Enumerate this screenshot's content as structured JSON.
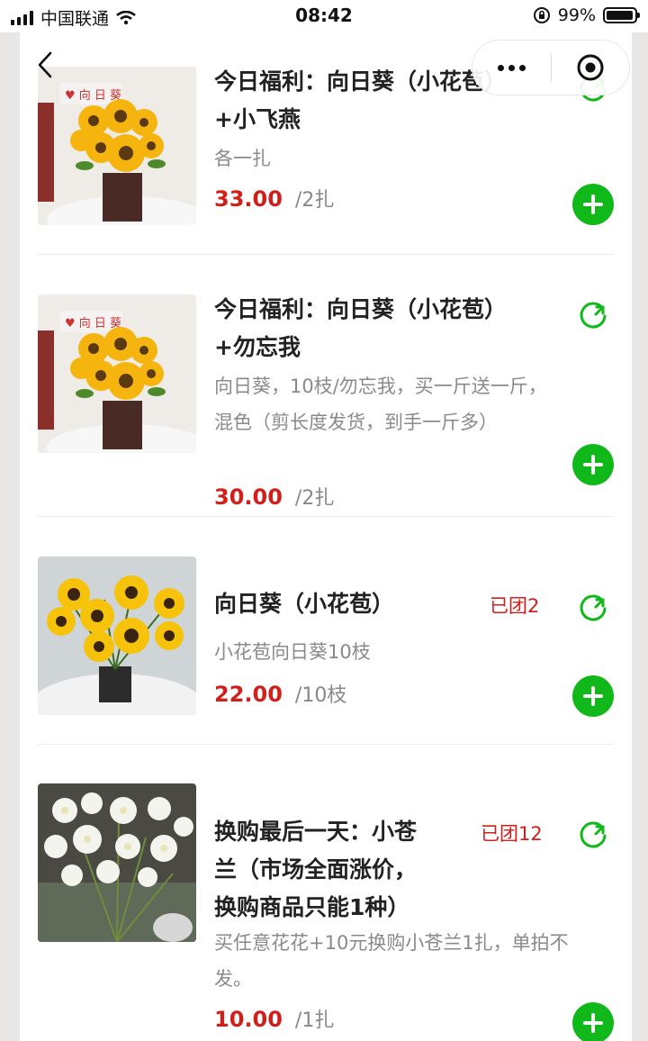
{
  "status_bar": {
    "carrier": "中国联通",
    "time": "08:42",
    "battery": "99%"
  },
  "nav": {
    "back_icon": "chevron-left-icon",
    "more_icon": "more-dots-icon",
    "home_icon": "target-icon"
  },
  "products": [
    {
      "title_line1": "今日福利：向日葵（小花苞）",
      "title_line2": "+小飞燕",
      "desc_line1": "各一扎",
      "desc_line2": "",
      "price": "33.00",
      "unit": "/2扎",
      "grouped": ""
    },
    {
      "title_line1": "今日福利：向日葵（小花苞）",
      "title_line2": "+勿忘我",
      "desc_line1": "向日葵，10枝/勿忘我，买一斤送一斤，",
      "desc_line2": "混色（剪长度发货，到手一斤多）",
      "price": "30.00",
      "unit": "/2扎",
      "grouped": ""
    },
    {
      "title_line1": "向日葵（小花苞）",
      "title_line2": "",
      "desc_line1": "小花苞向日葵10枝",
      "desc_line2": "",
      "price": "22.00",
      "unit": "/10枝",
      "grouped": "已团2"
    },
    {
      "title_line1": "换购最后一天：小苍",
      "title_line2": "兰（市场全面涨价，",
      "title_line3": "换购商品只能1种）",
      "desc_line1": "买任意花花+10元换购小苍兰1扎，单拍不",
      "desc_line2": "发。",
      "price": "10.00",
      "unit": "/1扎",
      "grouped": "已团12"
    }
  ],
  "colors": {
    "price": "#d0201c",
    "add_button": "#10b919",
    "share_icon": "#10b919"
  }
}
